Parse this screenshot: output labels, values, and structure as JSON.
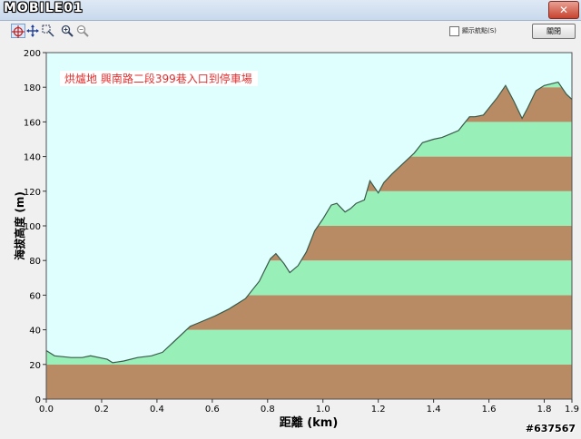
{
  "window": {
    "logo_text": "MOBILE01",
    "close_glyph": "✕"
  },
  "toolbar": {
    "tools": [
      {
        "name": "crosshair-tool-icon",
        "selected": true
      },
      {
        "name": "pan-tool-icon",
        "selected": false
      },
      {
        "name": "select-zoom-tool-icon",
        "selected": false
      },
      {
        "name": "zoom-in-tool-icon",
        "selected": false
      },
      {
        "name": "zoom-out-tool-icon",
        "selected": false
      }
    ],
    "show_points_label": "顯示航點(S)",
    "show_points_checked": false,
    "close_label": "關閉"
  },
  "watermark": "#637567",
  "colors": {
    "sky": "#dfffff",
    "band_light": "#98f0b8",
    "band_dark": "#b88b64",
    "line": "#3a5a4a",
    "title": "#e03030"
  },
  "chart_data": {
    "type": "area",
    "title": "烘爐地  興南路二段399巷入口到停車場",
    "xlabel": "距離  (km)",
    "ylabel": "海拔高度 (m)",
    "xlim": [
      0.0,
      1.9
    ],
    "ylim": [
      0,
      200
    ],
    "xticks": [
      "0.0",
      "0.2",
      "0.4",
      "0.6",
      "0.8",
      "1.0",
      "1.2",
      "1.4",
      "1.6",
      "1.8",
      "1.9"
    ],
    "xtick_values": [
      0.0,
      0.2,
      0.4,
      0.6,
      0.8,
      1.0,
      1.2,
      1.4,
      1.6,
      1.8,
      1.9
    ],
    "yticks": [
      "0",
      "20",
      "40",
      "60",
      "80",
      "100",
      "120",
      "140",
      "160",
      "180",
      "200"
    ],
    "ytick_values": [
      0,
      20,
      40,
      60,
      80,
      100,
      120,
      140,
      160,
      180,
      200
    ],
    "band_step": 20,
    "grid": false,
    "x": [
      0.0,
      0.03,
      0.09,
      0.13,
      0.16,
      0.22,
      0.24,
      0.28,
      0.33,
      0.38,
      0.42,
      0.46,
      0.52,
      0.55,
      0.61,
      0.66,
      0.72,
      0.77,
      0.81,
      0.83,
      0.86,
      0.88,
      0.91,
      0.94,
      0.97,
      1.0,
      1.03,
      1.05,
      1.08,
      1.1,
      1.12,
      1.15,
      1.17,
      1.2,
      1.22,
      1.25,
      1.29,
      1.33,
      1.36,
      1.4,
      1.43,
      1.46,
      1.49,
      1.53,
      1.55,
      1.58,
      1.6,
      1.63,
      1.66,
      1.69,
      1.72,
      1.74,
      1.77,
      1.8,
      1.85,
      1.88,
      1.9
    ],
    "y": [
      28,
      25,
      24,
      24,
      25,
      23,
      21,
      22,
      24,
      25,
      27,
      33,
      42,
      44,
      48,
      52,
      58,
      68,
      81,
      84,
      78,
      73,
      77,
      85,
      97,
      104,
      112,
      113,
      108,
      110,
      113,
      115,
      126,
      119,
      125,
      130,
      136,
      142,
      148,
      150,
      151,
      153,
      155,
      163,
      163,
      164,
      168,
      174,
      181,
      172,
      162,
      168,
      178,
      181,
      183,
      176,
      173
    ]
  }
}
